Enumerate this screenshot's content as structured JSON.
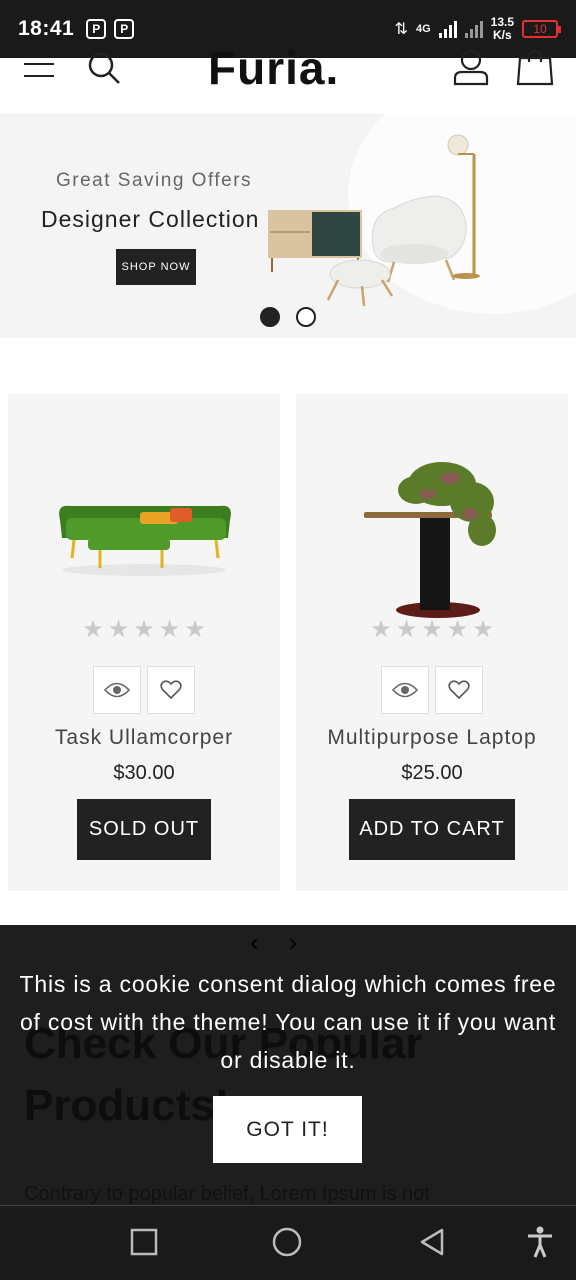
{
  "status_bar": {
    "time": "18:41",
    "app_icon_1": "P",
    "app_icon_2": "P",
    "network": "4G",
    "speed_top": "13.5",
    "speed_bottom": "K/s",
    "battery": "10"
  },
  "header": {
    "logo": "Furia."
  },
  "hero": {
    "subtitle": "Great Saving Offers",
    "title": "Designer Collection",
    "button_label": "SHOP NOW"
  },
  "products": [
    {
      "name": "Task Ullamcorper",
      "price": "$30.00",
      "rating": 0,
      "button_label": "SOLD OUT"
    },
    {
      "name": "Multipurpose Laptop",
      "price": "$25.00",
      "rating": 0,
      "button_label": "ADD TO CART"
    }
  ],
  "star_glyph": "★",
  "underlying": {
    "arrow_prev": "‹",
    "arrow_next": "›",
    "heading": "Check Our Popular Products!",
    "paragraph": "Contrary to popular belief, Lorem Ipsum is not"
  },
  "cookie": {
    "message": "This is a cookie consent dialog which comes free of cost with the theme! You can use it if you want or disable it.",
    "button_label": "GOT IT!"
  },
  "colors": {
    "dark": "#222222",
    "card_bg": "#f5f5f5",
    "overlay": "#1e1e1e",
    "battery_red": "#e53030"
  }
}
